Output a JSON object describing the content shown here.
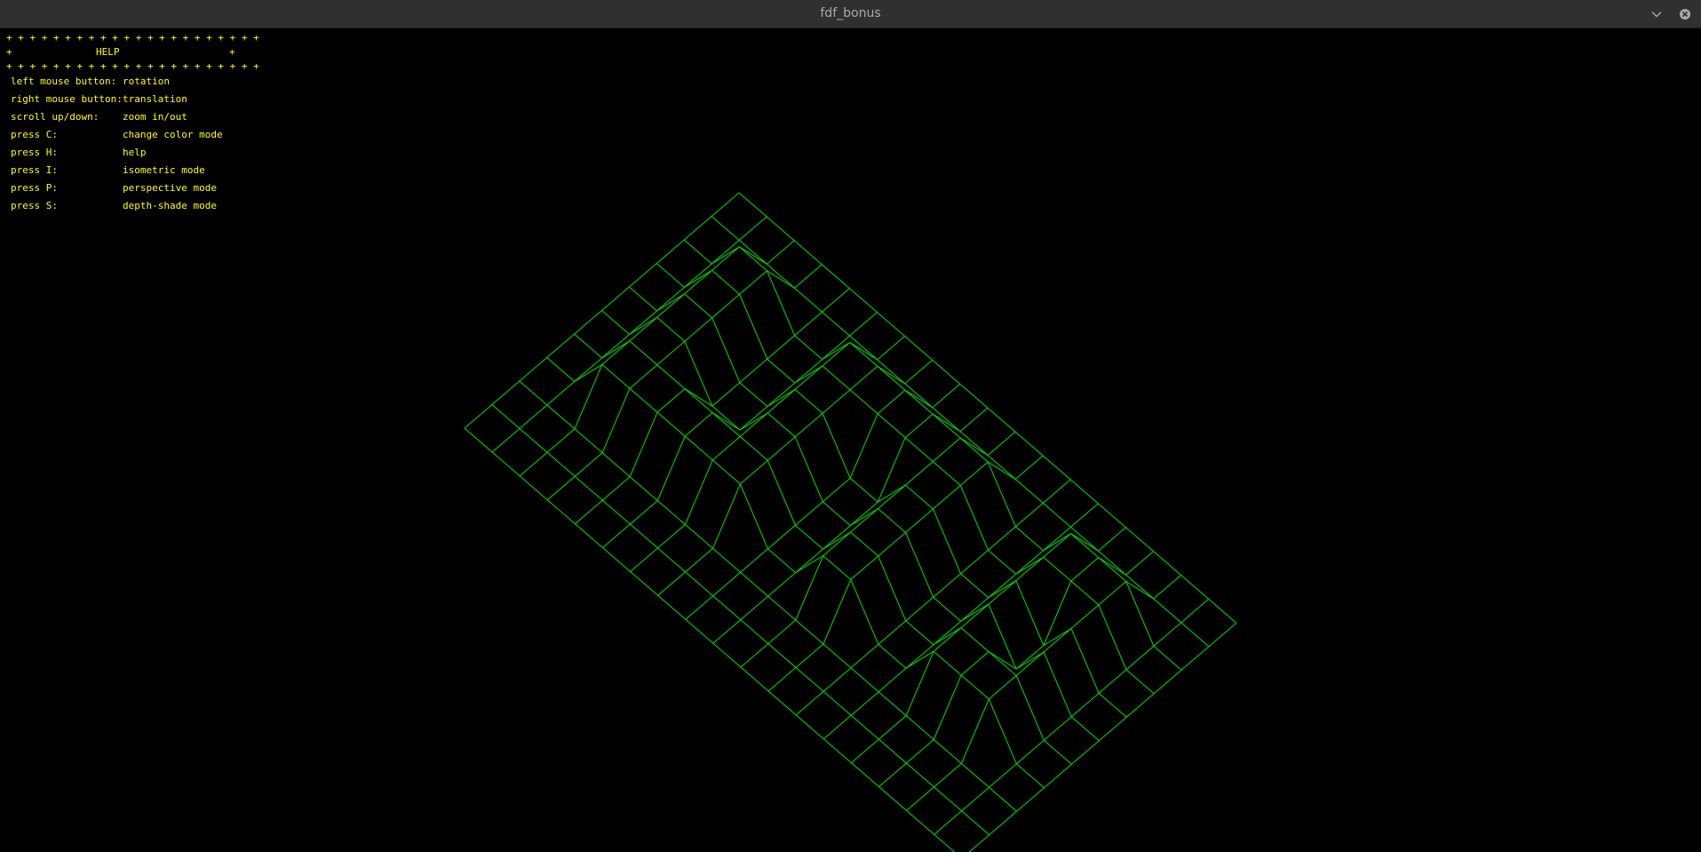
{
  "window": {
    "title": "fdf_bonus",
    "minimize_icon": "chevron-down-icon",
    "close_icon": "close-icon"
  },
  "help": {
    "border_top": "+ + + + + + + + + + + + + + + + + + + + + +",
    "border_left": "+",
    "title": "HELP",
    "border_right": "+",
    "border_bottom": "+ + + + + + + + + + + + + + + + + + + + + +",
    "rows": [
      {
        "key": "left mouse button:",
        "action": "rotation"
      },
      {
        "key": "right mouse button:",
        "action": "translation"
      },
      {
        "key": "scroll up/down:",
        "action": "zoom in/out"
      },
      {
        "key": "press C:",
        "action": "change color mode"
      },
      {
        "key": "press H:",
        "action": "help"
      },
      {
        "key": "press I:",
        "action": "isometric mode"
      },
      {
        "key": "press P:",
        "action": "perspective mode"
      },
      {
        "key": "press S:",
        "action": "depth-shade mode"
      }
    ]
  },
  "colors": {
    "background": "#000000",
    "titlebar": "#303030",
    "title_text": "#a9a9a9",
    "help_text": "#ffff00",
    "wire": "#00e000"
  },
  "map": {
    "rows": 19,
    "cols": 11,
    "heights": [
      [
        0,
        0,
        0,
        0,
        0,
        0,
        0,
        0,
        0,
        0,
        0
      ],
      [
        0,
        0,
        0,
        0,
        0,
        0,
        0,
        0,
        0,
        0,
        0
      ],
      [
        0,
        0,
        10,
        10,
        10,
        10,
        10,
        10,
        0,
        0,
        0
      ],
      [
        0,
        0,
        10,
        10,
        10,
        10,
        10,
        10,
        0,
        0,
        0
      ],
      [
        0,
        0,
        0,
        0,
        0,
        0,
        10,
        10,
        0,
        0,
        0
      ],
      [
        0,
        0,
        0,
        0,
        0,
        0,
        10,
        10,
        0,
        0,
        0
      ],
      [
        0,
        0,
        10,
        10,
        10,
        10,
        10,
        10,
        0,
        0,
        0
      ],
      [
        0,
        0,
        10,
        10,
        10,
        10,
        10,
        10,
        0,
        0,
        0
      ],
      [
        0,
        0,
        10,
        10,
        0,
        0,
        0,
        0,
        0,
        0,
        0
      ],
      [
        0,
        0,
        10,
        10,
        0,
        0,
        0,
        0,
        0,
        0,
        0
      ],
      [
        0,
        0,
        10,
        10,
        10,
        10,
        10,
        10,
        0,
        0,
        0
      ],
      [
        0,
        0,
        10,
        10,
        10,
        10,
        10,
        10,
        0,
        0,
        0
      ],
      [
        0,
        0,
        0,
        0,
        0,
        0,
        0,
        0,
        0,
        0,
        0
      ],
      [
        0,
        0,
        0,
        0,
        0,
        0,
        0,
        0,
        0,
        0,
        0
      ],
      [
        0,
        0,
        10,
        10,
        10,
        10,
        10,
        10,
        0,
        0,
        0
      ],
      [
        0,
        0,
        10,
        10,
        0,
        0,
        10,
        10,
        0,
        0,
        0
      ],
      [
        0,
        0,
        10,
        10,
        10,
        10,
        10,
        10,
        0,
        0,
        0
      ],
      [
        0,
        0,
        0,
        0,
        0,
        0,
        0,
        0,
        0,
        0,
        0
      ],
      [
        0,
        0,
        0,
        0,
        0,
        0,
        0,
        0,
        0,
        0,
        0
      ]
    ]
  }
}
